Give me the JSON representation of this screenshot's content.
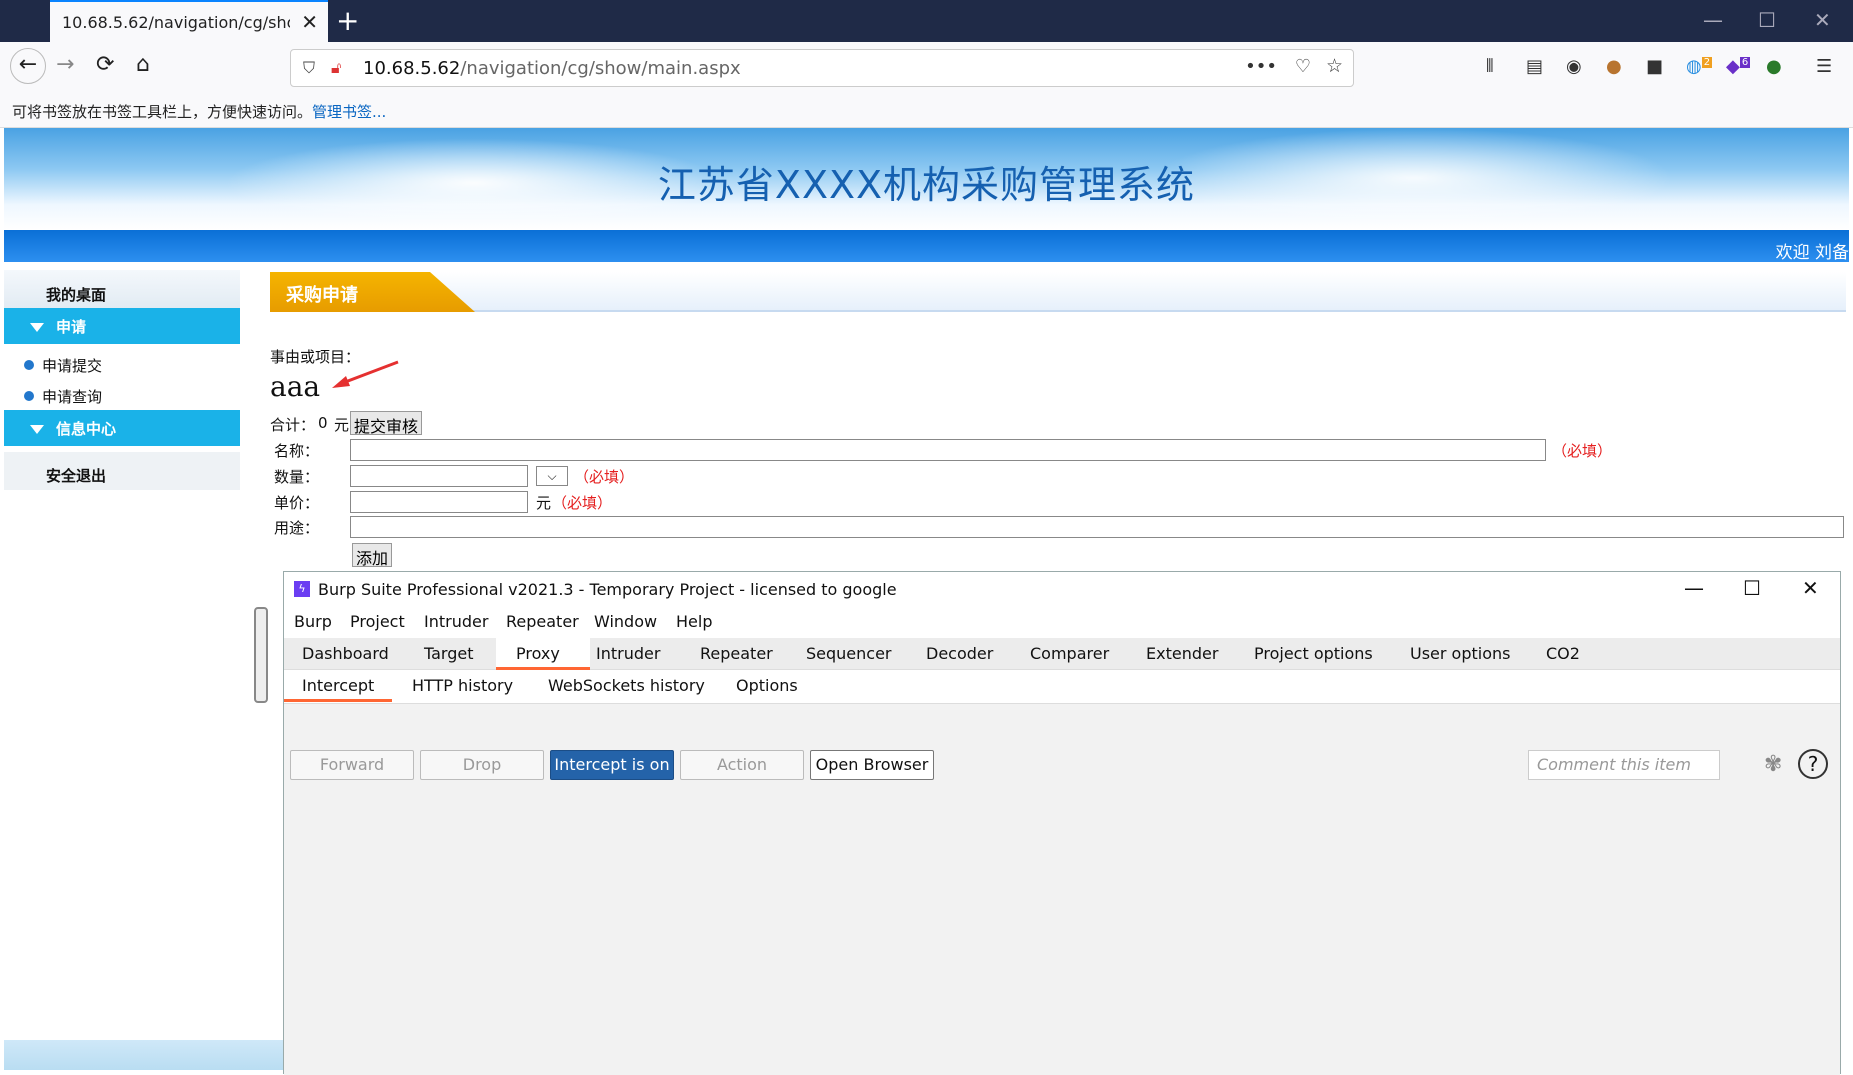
{
  "browser": {
    "tab_title": "10.68.5.62/navigation/cg/show/main.aspx",
    "url_host": "10.68.5.62",
    "url_path": "/navigation/cg/show/main.aspx",
    "bookmark_message": "可将书签放在书签工具栏上，方便快速访问。",
    "bookmark_link": "管理书签...",
    "badges": {
      "ext1": "2",
      "ext2": "6"
    }
  },
  "page": {
    "system_title": "江苏省XXXX机构采购管理系统",
    "welcome": "欢迎  刘备",
    "sidebar": {
      "desktop": "我的桌面",
      "section_apply": "申请",
      "items": [
        "申请提交",
        "申请查询"
      ],
      "section_info": "信息中心",
      "logout": "安全退出"
    },
    "header_tab": "采购申请",
    "reason_label": "事由或项目：",
    "reason_value": "aaa",
    "total_label": "合计：",
    "total_value": "0",
    "currency": "元",
    "submit_button": "提交审核",
    "fields": {
      "name_label": "名称：",
      "qty_label": "数量：",
      "price_label": "单价：",
      "usage_label": "用途：",
      "required": "（必填）",
      "price_unit": "元"
    },
    "add_button": "添加"
  },
  "burp": {
    "title": "Burp Suite Professional v2021.3 - Temporary Project - licensed to google",
    "menu": [
      "Burp",
      "Project",
      "Intruder",
      "Repeater",
      "Window",
      "Help"
    ],
    "tabs": [
      "Dashboard",
      "Target",
      "Proxy",
      "Intruder",
      "Repeater",
      "Sequencer",
      "Decoder",
      "Comparer",
      "Extender",
      "Project options",
      "User options",
      "CO2"
    ],
    "active_tab": "Proxy",
    "subtabs": [
      "Intercept",
      "HTTP history",
      "WebSockets history",
      "Options"
    ],
    "active_subtab": "Intercept",
    "buttons": {
      "forward": "Forward",
      "drop": "Drop",
      "intercept": "Intercept is on",
      "action": "Action",
      "open_browser": "Open Browser"
    },
    "comment_placeholder": "Comment this item",
    "help": "?"
  },
  "colors": {
    "accent_blue": "#2463a9",
    "tab_underline": "#ff6633",
    "sidebar_section": "#1ab2e8",
    "required_red": "#e52020"
  }
}
